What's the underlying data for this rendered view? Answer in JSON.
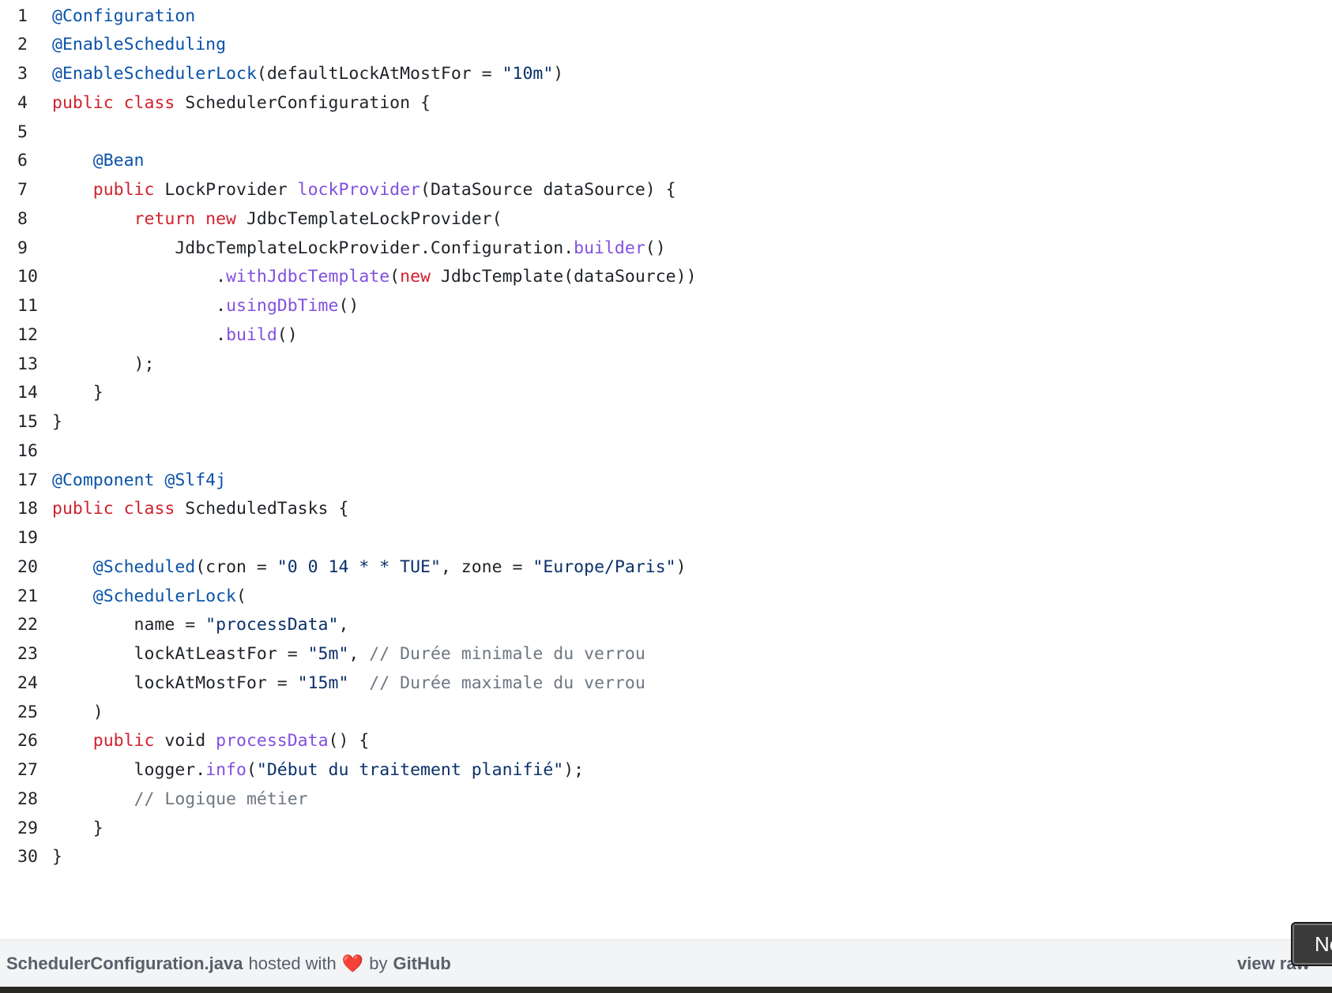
{
  "lines": [
    {
      "n": "1",
      "tokens": [
        [
          "ann",
          "@Configuration"
        ]
      ]
    },
    {
      "n": "2",
      "tokens": [
        [
          "ann",
          "@EnableScheduling"
        ]
      ]
    },
    {
      "n": "3",
      "tokens": [
        [
          "ann",
          "@EnableSchedulerLock"
        ],
        [
          "pl",
          "(defaultLockAtMostFor = "
        ],
        [
          "str",
          "\"10m\""
        ],
        [
          "pl",
          ")"
        ]
      ]
    },
    {
      "n": "4",
      "tokens": [
        [
          "kw",
          "public class"
        ],
        [
          "pl",
          " SchedulerConfiguration {"
        ]
      ]
    },
    {
      "n": "5",
      "tokens": []
    },
    {
      "n": "6",
      "tokens": [
        [
          "pl",
          "    "
        ],
        [
          "ann",
          "@Bean"
        ]
      ]
    },
    {
      "n": "7",
      "tokens": [
        [
          "pl",
          "    "
        ],
        [
          "kw",
          "public"
        ],
        [
          "pl",
          " LockProvider "
        ],
        [
          "fn",
          "lockProvider"
        ],
        [
          "pl",
          "(DataSource dataSource) {"
        ]
      ]
    },
    {
      "n": "8",
      "tokens": [
        [
          "pl",
          "        "
        ],
        [
          "kw",
          "return new"
        ],
        [
          "pl",
          " JdbcTemplateLockProvider("
        ]
      ]
    },
    {
      "n": "9",
      "tokens": [
        [
          "pl",
          "            JdbcTemplateLockProvider.Configuration."
        ],
        [
          "fn",
          "builder"
        ],
        [
          "pl",
          "()"
        ]
      ]
    },
    {
      "n": "10",
      "tokens": [
        [
          "pl",
          "                ."
        ],
        [
          "fn",
          "withJdbcTemplate"
        ],
        [
          "pl",
          "("
        ],
        [
          "kw",
          "new"
        ],
        [
          "pl",
          " JdbcTemplate(dataSource))"
        ]
      ]
    },
    {
      "n": "11",
      "tokens": [
        [
          "pl",
          "                ."
        ],
        [
          "fn",
          "usingDbTime"
        ],
        [
          "pl",
          "()"
        ]
      ]
    },
    {
      "n": "12",
      "tokens": [
        [
          "pl",
          "                ."
        ],
        [
          "fn",
          "build"
        ],
        [
          "pl",
          "()"
        ]
      ]
    },
    {
      "n": "13",
      "tokens": [
        [
          "pl",
          "        );"
        ]
      ]
    },
    {
      "n": "14",
      "tokens": [
        [
          "pl",
          "    }"
        ]
      ]
    },
    {
      "n": "15",
      "tokens": [
        [
          "pl",
          "}"
        ]
      ]
    },
    {
      "n": "16",
      "tokens": []
    },
    {
      "n": "17",
      "tokens": [
        [
          "ann",
          "@Component"
        ],
        [
          "pl",
          " "
        ],
        [
          "ann",
          "@Slf4j"
        ]
      ]
    },
    {
      "n": "18",
      "tokens": [
        [
          "kw",
          "public class"
        ],
        [
          "pl",
          " ScheduledTasks {"
        ]
      ]
    },
    {
      "n": "19",
      "tokens": []
    },
    {
      "n": "20",
      "tokens": [
        [
          "pl",
          "    "
        ],
        [
          "ann",
          "@Scheduled"
        ],
        [
          "pl",
          "(cron = "
        ],
        [
          "str",
          "\"0 0 14 * * TUE\""
        ],
        [
          "pl",
          ", zone = "
        ],
        [
          "str",
          "\"Europe/Paris\""
        ],
        [
          "pl",
          ")"
        ]
      ]
    },
    {
      "n": "21",
      "tokens": [
        [
          "pl",
          "    "
        ],
        [
          "ann",
          "@SchedulerLock"
        ],
        [
          "pl",
          "("
        ]
      ]
    },
    {
      "n": "22",
      "tokens": [
        [
          "pl",
          "        name = "
        ],
        [
          "str",
          "\"processData\""
        ],
        [
          "pl",
          ","
        ]
      ]
    },
    {
      "n": "23",
      "tokens": [
        [
          "pl",
          "        lockAtLeastFor = "
        ],
        [
          "str",
          "\"5m\""
        ],
        [
          "pl",
          ", "
        ],
        [
          "cm",
          "// Durée minimale du verrou"
        ]
      ]
    },
    {
      "n": "24",
      "tokens": [
        [
          "pl",
          "        lockAtMostFor = "
        ],
        [
          "str",
          "\"15m\""
        ],
        [
          "pl",
          "  "
        ],
        [
          "cm",
          "// Durée maximale du verrou"
        ]
      ]
    },
    {
      "n": "25",
      "tokens": [
        [
          "pl",
          "    )"
        ]
      ]
    },
    {
      "n": "26",
      "tokens": [
        [
          "pl",
          "    "
        ],
        [
          "kw",
          "public"
        ],
        [
          "pl",
          " void "
        ],
        [
          "fn",
          "processData"
        ],
        [
          "pl",
          "() {"
        ]
      ]
    },
    {
      "n": "27",
      "tokens": [
        [
          "pl",
          "        logger."
        ],
        [
          "fn",
          "info"
        ],
        [
          "pl",
          "("
        ],
        [
          "str",
          "\"Début du traitement planifié\""
        ],
        [
          "pl",
          ");"
        ]
      ]
    },
    {
      "n": "28",
      "tokens": [
        [
          "pl",
          "        "
        ],
        [
          "cm",
          "// Logique métier"
        ]
      ]
    },
    {
      "n": "29",
      "tokens": [
        [
          "pl",
          "    }"
        ]
      ]
    },
    {
      "n": "30",
      "tokens": [
        [
          "pl",
          "}"
        ]
      ]
    }
  ],
  "footer": {
    "file_name": "SchedulerConfiguration.java",
    "hosted_with": "hosted with",
    "heart": "❤️",
    "by": "by",
    "github": "GitHub",
    "view_raw": "view raw"
  },
  "floating_button": {
    "label": "Ne"
  }
}
